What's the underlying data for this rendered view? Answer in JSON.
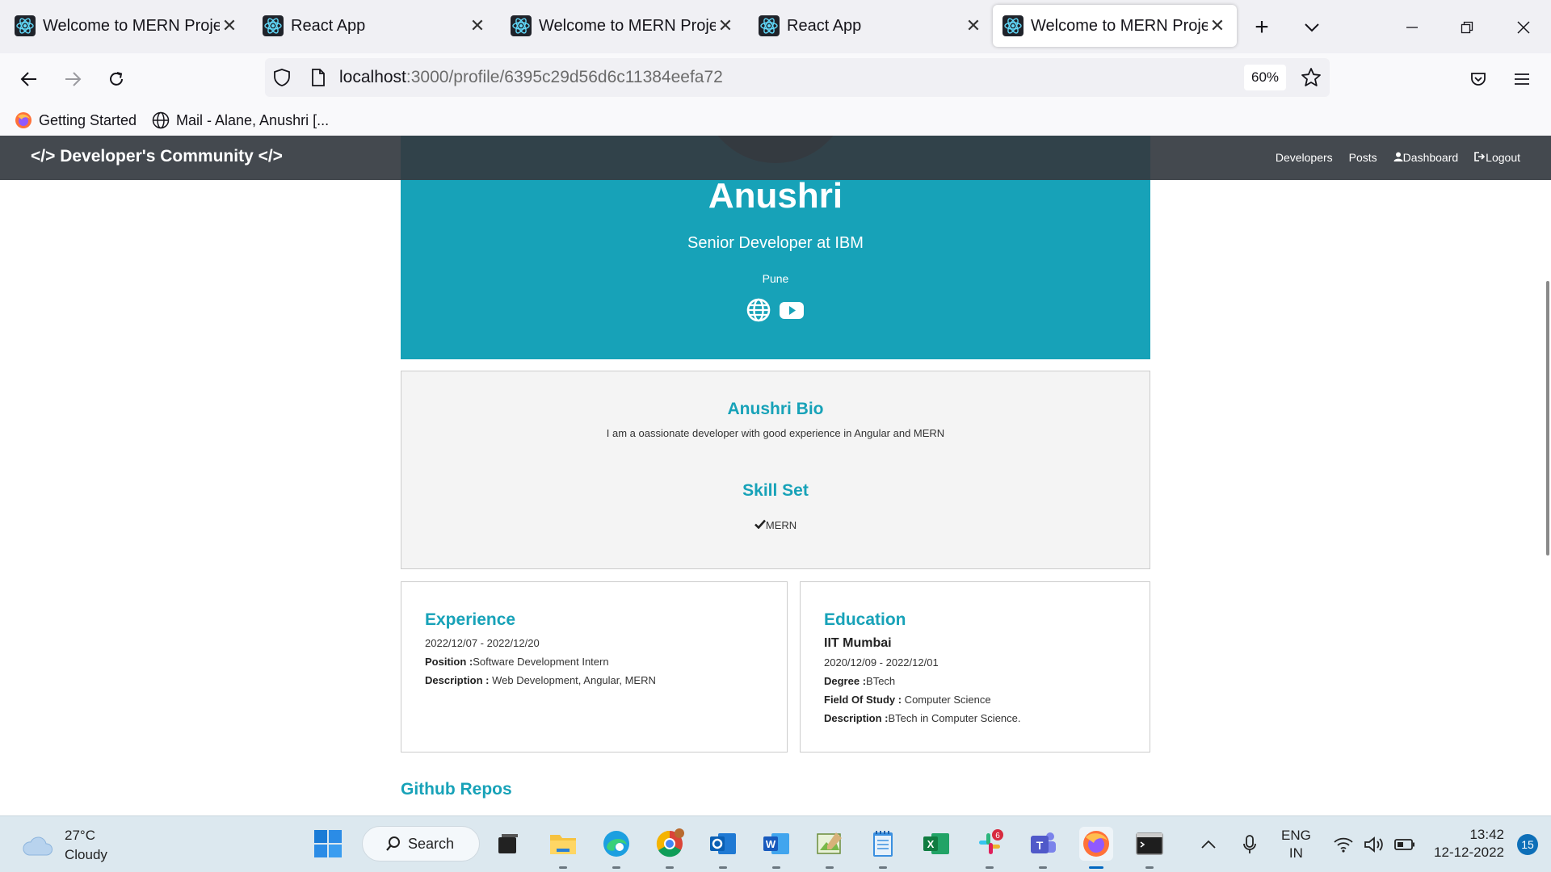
{
  "browser": {
    "tabs": [
      {
        "title": "Welcome to MERN Project",
        "active": false
      },
      {
        "title": "React App",
        "active": false
      },
      {
        "title": "Welcome to MERN Project",
        "active": false
      },
      {
        "title": "React App",
        "active": false
      },
      {
        "title": "Welcome to MERN Project",
        "active": true
      }
    ],
    "url_host": "localhost",
    "url_path": ":3000/profile/6395c29d56d6c11384eefa72",
    "zoom": "60%",
    "bookmarks": [
      {
        "label": "Getting Started",
        "icon": "firefox-icon"
      },
      {
        "label": "Mail - Alane, Anushri [...",
        "icon": "globe-icon"
      }
    ]
  },
  "site": {
    "brand": "</> Developer's Community </>",
    "nav_links": [
      "Developers",
      "Posts",
      "Dashboard",
      "Logout"
    ]
  },
  "profile": {
    "name": "Anushri",
    "status": "Senior Developer at IBM",
    "location": "Pune",
    "social_icons": [
      "globe-icon",
      "youtube-icon"
    ]
  },
  "bio": {
    "title": "Anushri Bio",
    "text": "I am a oassionate developer with good experience in Angular and MERN",
    "skills_title": "Skill Set",
    "skills": [
      "MERN"
    ]
  },
  "experience": {
    "title": "Experience",
    "dates": "2022/12/07 - 2022/12/20",
    "position_label": "Position :",
    "position": "Software Development Intern",
    "description_label": "Description :",
    "description": " Web Development, Angular, MERN"
  },
  "education": {
    "title": "Education",
    "school": "IIT Mumbai",
    "dates": "2020/12/09 - 2022/12/01",
    "degree_label": "Degree :",
    "degree": "BTech",
    "field_label": "Field Of Study :",
    "field": " Computer Science",
    "description_label": "Description :",
    "description": "BTech in Computer Science."
  },
  "repos_title": "Github Repos",
  "taskbar": {
    "weather_temp": "27°C",
    "weather_desc": "Cloudy",
    "search_label": "Search",
    "lang_1": "ENG",
    "lang_2": "IN",
    "time": "13:42",
    "date": "12-12-2022",
    "notifications": "15",
    "slack_badge": "6"
  },
  "colors": {
    "accent": "#17a2b8",
    "navbar": "#343a40"
  }
}
